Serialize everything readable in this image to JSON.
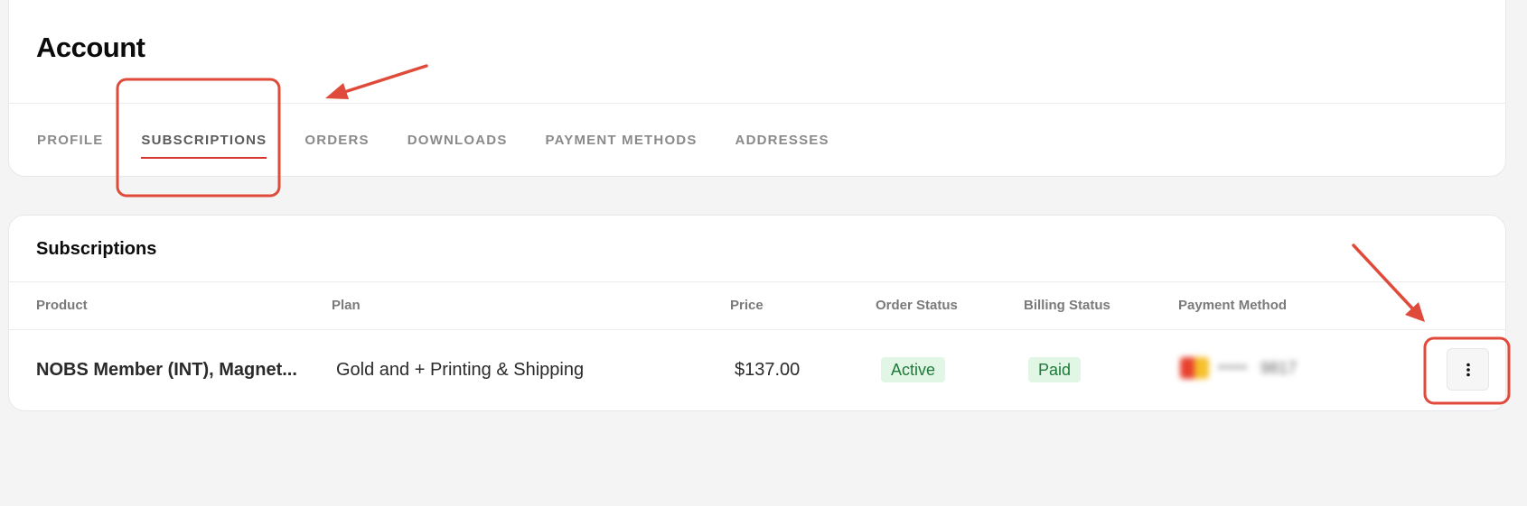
{
  "account": {
    "title": "Account",
    "tabs": [
      {
        "label": "PROFILE",
        "active": false
      },
      {
        "label": "SUBSCRIPTIONS",
        "active": true
      },
      {
        "label": "ORDERS",
        "active": false
      },
      {
        "label": "DOWNLOADS",
        "active": false
      },
      {
        "label": "PAYMENT METHODS",
        "active": false
      },
      {
        "label": "ADDRESSES",
        "active": false
      }
    ]
  },
  "subscriptions": {
    "title": "Subscriptions",
    "columns": {
      "product": "Product",
      "plan": "Plan",
      "price": "Price",
      "order_status": "Order Status",
      "billing_status": "Billing Status",
      "payment_method": "Payment Method"
    },
    "rows": [
      {
        "product": "NOBS Member (INT), Magnet...",
        "plan": "Gold and + Printing & Shipping",
        "price": "$137.00",
        "order_status": "Active",
        "billing_status": "Paid",
        "payment_method": {
          "masked": "•••••",
          "last4": "9817",
          "icon": "credit-card-icon"
        },
        "actions_icon": "vertical-dots-icon"
      }
    ]
  },
  "colors": {
    "accent": "#d6342c",
    "annotation": "#e04a3a",
    "badge_bg": "#e2f6e6",
    "badge_text": "#1d7a38",
    "page_bg": "#f4f4f4"
  }
}
